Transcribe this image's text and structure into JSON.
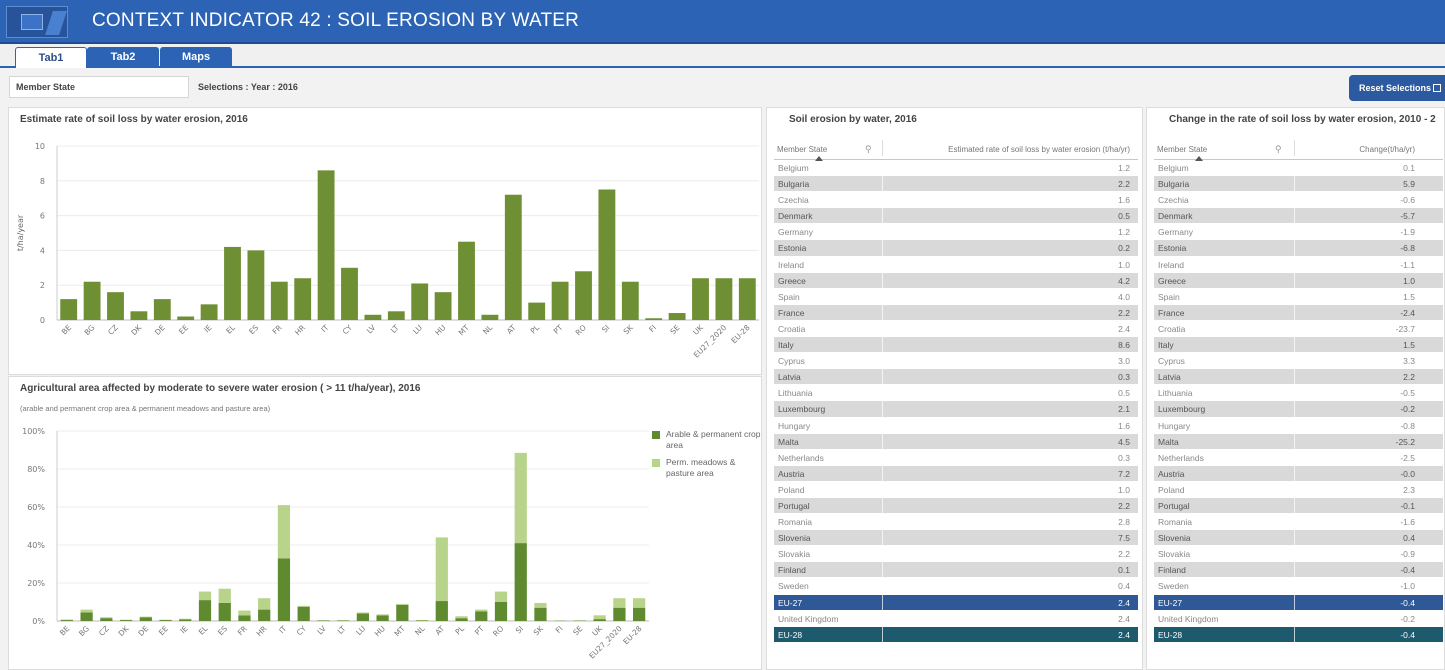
{
  "header": {
    "title": "CONTEXT INDICATOR 42 : SOIL EROSION BY WATER"
  },
  "tabs": [
    {
      "label": "Tab1",
      "active": true
    },
    {
      "label": "Tab2",
      "active": false
    },
    {
      "label": "Maps",
      "active": false
    }
  ],
  "selection_bar": {
    "member_state_label": "Member State",
    "selections_text": "Selections : Year : 2016",
    "reset_label": "Reset Selections"
  },
  "charts_text": {
    "chart1_title": "Estimate rate of soil loss by water erosion, 2016",
    "chart2_title": "Agricultural area affected by moderate to severe water erosion ( > 11 t/ha/year), 2016",
    "chart2_subtitle": "(arable and permanent crop area & permanent meadows and pasture area)",
    "legend": [
      "Arable & permanent crop area",
      "Perm. meadows & pasture area"
    ]
  },
  "chart_data": [
    {
      "type": "bar",
      "title": "Estimate rate of soil loss by water erosion, 2016",
      "ylabel": "t/ha/year",
      "ylim": [
        0,
        10
      ],
      "yticks": [
        0,
        2,
        4,
        6,
        8,
        10
      ],
      "color": "#6f8f35",
      "grid": true,
      "categories": [
        "BE",
        "BG",
        "CZ",
        "DK",
        "DE",
        "EE",
        "IE",
        "EL",
        "ES",
        "FR",
        "HR",
        "IT",
        "CY",
        "LV",
        "LT",
        "LU",
        "HU",
        "MT",
        "NL",
        "AT",
        "PL",
        "PT",
        "RO",
        "SI",
        "SK",
        "FI",
        "SE",
        "UK",
        "EU27_2020",
        "EU-28"
      ],
      "values": [
        1.2,
        2.2,
        1.6,
        0.5,
        1.2,
        0.2,
        0.9,
        4.2,
        4.0,
        2.2,
        2.4,
        8.6,
        3.0,
        0.3,
        0.5,
        2.1,
        1.6,
        4.5,
        0.3,
        7.2,
        1.0,
        2.2,
        2.8,
        7.5,
        2.2,
        0.1,
        0.4,
        2.4,
        2.4,
        2.4
      ]
    },
    {
      "type": "bar",
      "stacked": true,
      "title": "Agricultural area affected by moderate to severe water erosion ( > 11 t/ha/year), 2016",
      "ylim": [
        0,
        100
      ],
      "yticks": [
        "0%",
        "20%",
        "40%",
        "60%",
        "80%",
        "100%"
      ],
      "grid": true,
      "legend_position": "right",
      "categories": [
        "BE",
        "BG",
        "CZ",
        "DK",
        "DE",
        "EE",
        "IE",
        "EL",
        "ES",
        "FR",
        "HR",
        "IT",
        "CY",
        "LV",
        "LT",
        "LU",
        "HU",
        "MT",
        "NL",
        "AT",
        "PL",
        "PT",
        "RO",
        "SI",
        "SK",
        "FI",
        "SE",
        "UK",
        "EU27_2020",
        "EU-28"
      ],
      "series": [
        {
          "name": "Arable & permanent crop area",
          "color": "#5f8a2f",
          "values": [
            0.5,
            4.5,
            1.5,
            0.5,
            2.0,
            0.5,
            0.8,
            11.0,
            9.5,
            3.0,
            6.0,
            33.0,
            7.5,
            0.3,
            0.3,
            4.0,
            3.0,
            8.5,
            0.3,
            10.5,
            1.5,
            5.0,
            10.0,
            41.0,
            7.0,
            0.2,
            0.2,
            1.0,
            7.0,
            7.0
          ]
        },
        {
          "name": "Perm. meadows & pasture area",
          "color": "#b8d48a",
          "values": [
            0.3,
            1.5,
            0.5,
            0.2,
            0.3,
            0.2,
            0.4,
            4.5,
            7.5,
            2.5,
            6.0,
            28.0,
            0.5,
            0.1,
            0.1,
            0.5,
            0.5,
            0.5,
            0.2,
            33.5,
            1.0,
            1.0,
            5.5,
            47.5,
            2.5,
            0.1,
            0.2,
            2.0,
            5.0,
            5.0
          ]
        }
      ]
    },
    {
      "type": "table",
      "title": "Soil erosion by water, 2016",
      "columns": [
        "Member State",
        "Estimated rate of soil loss by water erosion (t/ha/yr)"
      ],
      "rows": [
        [
          "Belgium",
          "1.2"
        ],
        [
          "Bulgaria",
          "2.2"
        ],
        [
          "Czechia",
          "1.6"
        ],
        [
          "Denmark",
          "0.5"
        ],
        [
          "Germany",
          "1.2"
        ],
        [
          "Estonia",
          "0.2"
        ],
        [
          "Ireland",
          "1.0"
        ],
        [
          "Greece",
          "4.2"
        ],
        [
          "Spain",
          "4.0"
        ],
        [
          "France",
          "2.2"
        ],
        [
          "Croatia",
          "2.4"
        ],
        [
          "Italy",
          "8.6"
        ],
        [
          "Cyprus",
          "3.0"
        ],
        [
          "Latvia",
          "0.3"
        ],
        [
          "Lithuania",
          "0.5"
        ],
        [
          "Luxembourg",
          "2.1"
        ],
        [
          "Hungary",
          "1.6"
        ],
        [
          "Malta",
          "4.5"
        ],
        [
          "Netherlands",
          "0.3"
        ],
        [
          "Austria",
          "7.2"
        ],
        [
          "Poland",
          "1.0"
        ],
        [
          "Portugal",
          "2.2"
        ],
        [
          "Romania",
          "2.8"
        ],
        [
          "Slovenia",
          "7.5"
        ],
        [
          "Slovakia",
          "2.2"
        ],
        [
          "Finland",
          "0.1"
        ],
        [
          "Sweden",
          "0.4"
        ],
        [
          "EU-27",
          "2.4"
        ],
        [
          "United Kingdom",
          "2.4"
        ],
        [
          "EU-28",
          "2.4"
        ]
      ]
    },
    {
      "type": "table",
      "title": "Change in the rate of soil loss by water erosion, 2010 - 2",
      "columns": [
        "Member State",
        "Change(t/ha/yr)"
      ],
      "rows": [
        [
          "Belgium",
          "0.1"
        ],
        [
          "Bulgaria",
          "5.9"
        ],
        [
          "Czechia",
          "-0.6"
        ],
        [
          "Denmark",
          "-5.7"
        ],
        [
          "Germany",
          "-1.9"
        ],
        [
          "Estonia",
          "-6.8"
        ],
        [
          "Ireland",
          "-1.1"
        ],
        [
          "Greece",
          "1.0"
        ],
        [
          "Spain",
          "1.5"
        ],
        [
          "France",
          "-2.4"
        ],
        [
          "Croatia",
          "-23.7"
        ],
        [
          "Italy",
          "1.5"
        ],
        [
          "Cyprus",
          "3.3"
        ],
        [
          "Latvia",
          "2.2"
        ],
        [
          "Lithuania",
          "-0.5"
        ],
        [
          "Luxembourg",
          "-0.2"
        ],
        [
          "Hungary",
          "-0.8"
        ],
        [
          "Malta",
          "-25.2"
        ],
        [
          "Netherlands",
          "-2.5"
        ],
        [
          "Austria",
          "-0.0"
        ],
        [
          "Poland",
          "2.3"
        ],
        [
          "Portugal",
          "-0.1"
        ],
        [
          "Romania",
          "-1.6"
        ],
        [
          "Slovenia",
          "0.4"
        ],
        [
          "Slovakia",
          "-0.9"
        ],
        [
          "Finland",
          "-0.4"
        ],
        [
          "Sweden",
          "-1.0"
        ],
        [
          "EU-27",
          "-0.4"
        ],
        [
          "United Kingdom",
          "-0.2"
        ],
        [
          "EU-28",
          "-0.4"
        ]
      ]
    }
  ],
  "colors": {
    "header_blue": "#2c63b5",
    "bar_green": "#6f8f35",
    "eu27_row": "#2e5896",
    "eu28_row": "#1e5a6e"
  }
}
